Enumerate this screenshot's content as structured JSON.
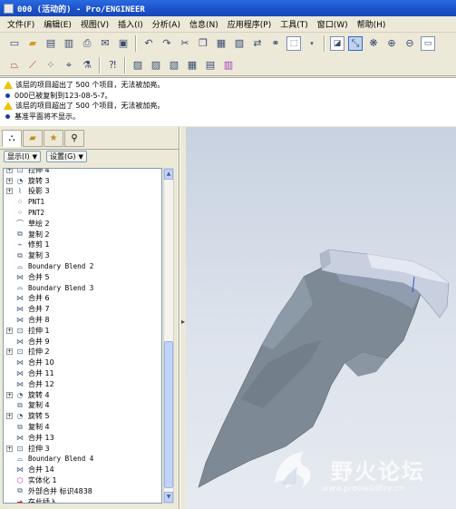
{
  "window": {
    "title": "000 (活动的) - Pro/ENGINEER"
  },
  "menu": [
    "文件(F)",
    "编辑(E)",
    "视图(V)",
    "插入(I)",
    "分析(A)",
    "信息(N)",
    "应用程序(P)",
    "工具(T)",
    "窗口(W)",
    "帮助(H)"
  ],
  "messages": [
    {
      "icon": "warning",
      "text": "该层的项目超出了 500 个项目，无法被加亮。"
    },
    {
      "icon": "info",
      "text": "000已被复制到123-08-5-7。"
    },
    {
      "icon": "warning",
      "text": "该层的项目超出了 500 个项目，无法被加亮。"
    },
    {
      "icon": "info",
      "text": "基准平面将不显示。"
    }
  ],
  "panel": {
    "show_button": "显示(I)",
    "settings_button": "设置(G)"
  },
  "tree": [
    {
      "label": "拉伸 4",
      "expandable": true,
      "icon": "extrude"
    },
    {
      "label": "旋转 3",
      "expandable": true,
      "icon": "revolve"
    },
    {
      "label": "投影 3",
      "expandable": true,
      "icon": "project"
    },
    {
      "label": "PNT1",
      "expandable": false,
      "icon": "point",
      "mono": true
    },
    {
      "label": "PNT2",
      "expandable": false,
      "icon": "point",
      "mono": true
    },
    {
      "label": "草绘 2",
      "expandable": false,
      "icon": "sketch"
    },
    {
      "label": "复制 2",
      "expandable": false,
      "icon": "copy"
    },
    {
      "label": "修剪 1",
      "expandable": false,
      "icon": "trim"
    },
    {
      "label": "复制 3",
      "expandable": false,
      "icon": "copy"
    },
    {
      "label": "Boundary Blend 2",
      "expandable": false,
      "icon": "blend",
      "mono": true
    },
    {
      "label": "合并 5",
      "expandable": false,
      "icon": "merge"
    },
    {
      "label": "Boundary Blend 3",
      "expandable": false,
      "icon": "blend",
      "mono": true
    },
    {
      "label": "合并 6",
      "expandable": false,
      "icon": "merge"
    },
    {
      "label": "合并 7",
      "expandable": false,
      "icon": "merge"
    },
    {
      "label": "合并 8",
      "expandable": false,
      "icon": "merge"
    },
    {
      "label": "拉伸 1",
      "expandable": true,
      "icon": "extrude"
    },
    {
      "label": "合并 9",
      "expandable": false,
      "icon": "merge"
    },
    {
      "label": "拉伸 2",
      "expandable": true,
      "icon": "extrude"
    },
    {
      "label": "合并 10",
      "expandable": false,
      "icon": "merge"
    },
    {
      "label": "合并 11",
      "expandable": false,
      "icon": "merge"
    },
    {
      "label": "合并 12",
      "expandable": false,
      "icon": "merge"
    },
    {
      "label": "旋转 4",
      "expandable": true,
      "icon": "revolve"
    },
    {
      "label": "复制 4",
      "expandable": false,
      "icon": "copy"
    },
    {
      "label": "旋转 5",
      "expandable": true,
      "icon": "revolve"
    },
    {
      "label": "复制 4",
      "expandable": false,
      "icon": "copy"
    },
    {
      "label": "合并 13",
      "expandable": false,
      "icon": "merge"
    },
    {
      "label": "拉伸 3",
      "expandable": true,
      "icon": "extrude"
    },
    {
      "label": "Boundary Blend 4",
      "expandable": false,
      "icon": "blend",
      "mono": true
    },
    {
      "label": "合并 14",
      "expandable": false,
      "icon": "merge"
    },
    {
      "label": "实体化 1",
      "expandable": false,
      "icon": "solidify",
      "style": "pink"
    },
    {
      "label": "外部合并 标识4838",
      "expandable": false,
      "icon": "external-merge"
    },
    {
      "label": "在此插入",
      "expandable": false,
      "icon": "insert-here",
      "style": "red"
    }
  ],
  "watermark": {
    "text": "野火论坛",
    "url": "www.proewildfire.cn"
  },
  "colors": {
    "titlebar": "#1a50c8",
    "model_surface": "#7e8c99",
    "model_highlight": "#e0e6f0",
    "viewport_bg": "#d8dfe8"
  }
}
